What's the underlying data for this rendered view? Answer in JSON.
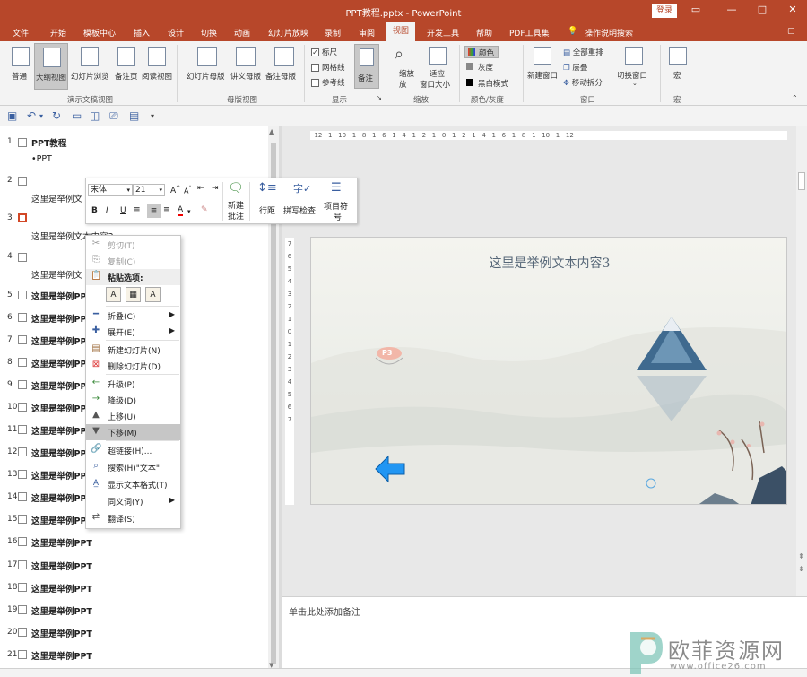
{
  "window": {
    "title": "PPT教程.pptx  -  PowerPoint",
    "login": "登录",
    "min": "—",
    "restore": "☐",
    "max": "□",
    "close": "✕"
  },
  "tabs": [
    "文件",
    "开始",
    "模板中心",
    "插入",
    "设计",
    "切换",
    "动画",
    "幻灯片放映",
    "录制",
    "审阅",
    "视图",
    "开发工具",
    "帮助",
    "PDF工具集",
    "操作说明搜索"
  ],
  "ribbon": {
    "views": [
      "普通",
      "大纲视图",
      "幻灯片浏览",
      "备注页",
      "阅读视图"
    ],
    "views_group": "演示文稿视图",
    "master": [
      "幻灯片母版",
      "讲义母版",
      "备注母版"
    ],
    "master_group": "母版视图",
    "show": {
      "ruler": "标尺",
      "grid": "网格线",
      "guides": "参考线",
      "notes": "备注",
      "group": "显示"
    },
    "zoom": {
      "zoom": "缩放",
      "zoom2": "放",
      "fit": "适应",
      "fit2": "窗口大小",
      "group": "缩放"
    },
    "color": {
      "color": "颜色",
      "gray": "灰度",
      "bw": "黑白模式",
      "group": "颜色/灰度"
    },
    "window": {
      "new": "新建窗口",
      "arrange": "全部重排",
      "cascade": "层叠",
      "move": "移动拆分",
      "switch": "切换窗口",
      "group": "窗口"
    },
    "macro": {
      "label": "宏",
      "group": "宏"
    }
  },
  "outline": [
    {
      "n": "1",
      "title": "PPT教程",
      "body": "•PPT"
    },
    {
      "n": "2",
      "title": "",
      "body": "这里是举例文"
    },
    {
      "n": "3",
      "title": "",
      "body": "这里是举例文本内容3"
    },
    {
      "n": "4",
      "title": "",
      "body": "这里是举例文"
    },
    {
      "n": "5",
      "title": "这里是举例PPT"
    },
    {
      "n": "6",
      "title": "这里是举例PPT"
    },
    {
      "n": "7",
      "title": "这里是举例PPT"
    },
    {
      "n": "8",
      "title": "这里是举例PPT"
    },
    {
      "n": "9",
      "title": "这里是举例PPT"
    },
    {
      "n": "10",
      "title": "这里是举例PPT"
    },
    {
      "n": "11",
      "title": "这里是举例PPT"
    },
    {
      "n": "12",
      "title": "这里是举例PPT"
    },
    {
      "n": "13",
      "title": "这里是举例PPT"
    },
    {
      "n": "14",
      "title": "这里是举例PPT"
    },
    {
      "n": "15",
      "title": "这里是举例PPT"
    },
    {
      "n": "16",
      "title": "这里是举例PPT"
    },
    {
      "n": "17",
      "title": "这里是举例PPT"
    },
    {
      "n": "18",
      "title": "这里是举例PPT"
    },
    {
      "n": "19",
      "title": "这里是举例PPT"
    },
    {
      "n": "20",
      "title": "这里是举例PPT"
    },
    {
      "n": "21",
      "title": "这里是举例PPT"
    }
  ],
  "minitoolbar": {
    "font": "宋体",
    "size": "21",
    "new_comment": "新建",
    "new_comment2": "批注",
    "spacing": "行距",
    "spell": "拼写检查",
    "bullets": "项目符",
    "bullets2": "号"
  },
  "context_menu": {
    "cut": "剪切(T)",
    "copy": "复制(C)",
    "paste_options": "粘贴选项:",
    "collapse": "折叠(C)",
    "expand": "展开(E)",
    "new_slide": "新建幻灯片(N)",
    "delete_slide": "删除幻灯片(D)",
    "promote": "升级(P)",
    "demote": "降级(D)",
    "move_up": "上移(U)",
    "move_down": "下移(M)",
    "hyperlink": "超链接(H)...",
    "search": "搜索(H)\"文本\"",
    "show_format": "显示文本格式(T)",
    "synonyms": "同义词(Y)",
    "translate": "翻译(S)"
  },
  "slide": {
    "title": "这里是举例文本内容3",
    "badge": "P3"
  },
  "ruler_h": "· 12 · 1 · 10 · 1 · 8 · 1 · 6 · 1 · 4 · 1 · 2 · 1 · 0 · 1 · 2 · 1 · 4 · 1 · 6 · 1 · 8 · 1 · 10 · 1 · 12 ·",
  "ruler_v": [
    "7",
    "6",
    "5",
    "4",
    "3",
    "2",
    "1",
    "0",
    "1",
    "2",
    "3",
    "4",
    "5",
    "6",
    "7"
  ],
  "notes": "单击此处添加备注",
  "watermark": {
    "cn": "欧菲资源网",
    "url": "www.office26.com"
  },
  "colors": {
    "brand": "#b7472a"
  }
}
